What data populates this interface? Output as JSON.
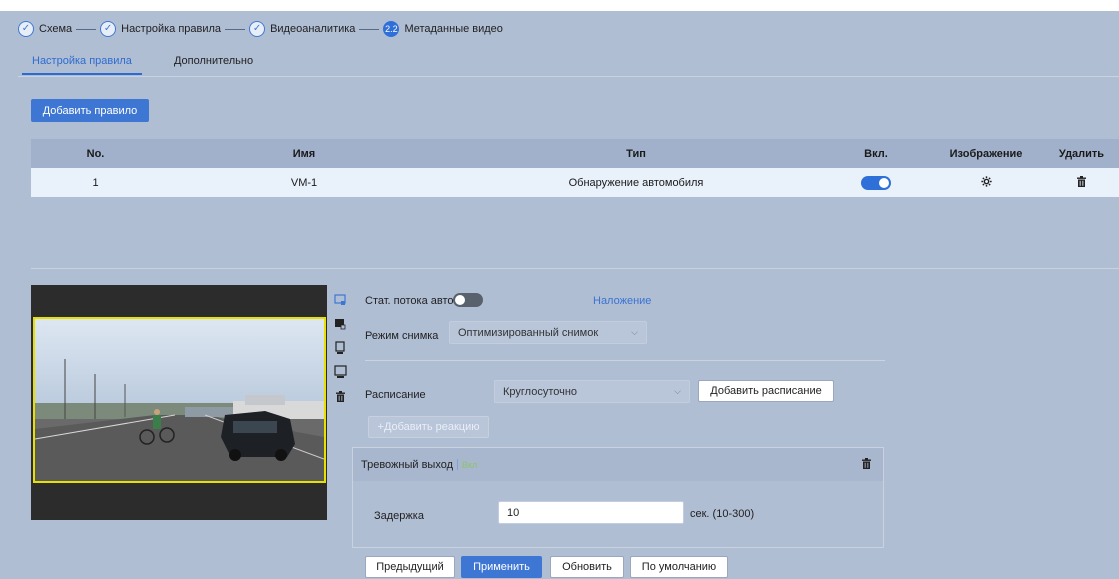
{
  "wizard": {
    "steps": [
      {
        "label": "Схема",
        "icon": "check-icon"
      },
      {
        "label": "Настройка правила",
        "icon": "check-icon"
      },
      {
        "label": "Видеоаналитика",
        "icon": "check-icon"
      },
      {
        "label": "Метаданные видео",
        "number": "2.2"
      }
    ]
  },
  "tabs": [
    {
      "label": "Настройка правила",
      "active": true
    },
    {
      "label": "Дополнительно",
      "active": false
    }
  ],
  "add_rule_label": "Добавить правило",
  "table": {
    "headers": [
      "No.",
      "Имя",
      "Тип",
      "Вкл.",
      "Изображение",
      "Удалить"
    ],
    "rows": [
      {
        "no": "1",
        "name": "VM-1",
        "type": "Обнаружение автомобиля",
        "enabled": true
      }
    ]
  },
  "video_tools": [
    "draw-region-icon",
    "region-icon",
    "target-filter-icon",
    "max-size-icon",
    "delete-icon"
  ],
  "settings": {
    "stream_stats_label": "Стат. потока авто",
    "stream_stats_enabled": false,
    "overlay_link": "Наложение",
    "snapshot_mode_label": "Режим снимка",
    "snapshot_mode_value": "Оптимизированный снимок",
    "schedule_label": "Расписание",
    "schedule_value": "Круглосуточно",
    "add_schedule_label": "Добавить расписание",
    "add_reaction_label": "+Добавить реакцию",
    "alarm_out_label": "Тревожный выход",
    "alarm_out_badge": "Вкл",
    "delay_label": "Задержка",
    "delay_value": "10",
    "delay_unit": "сек. (10-300)"
  },
  "footer": {
    "prev": "Предыдущий",
    "apply": "Применить",
    "refresh": "Обновить",
    "default": "По умолчанию"
  },
  "colors": {
    "accent": "#3e76d4",
    "background": "#b0bed4",
    "detection_frame": "#e8e000"
  }
}
